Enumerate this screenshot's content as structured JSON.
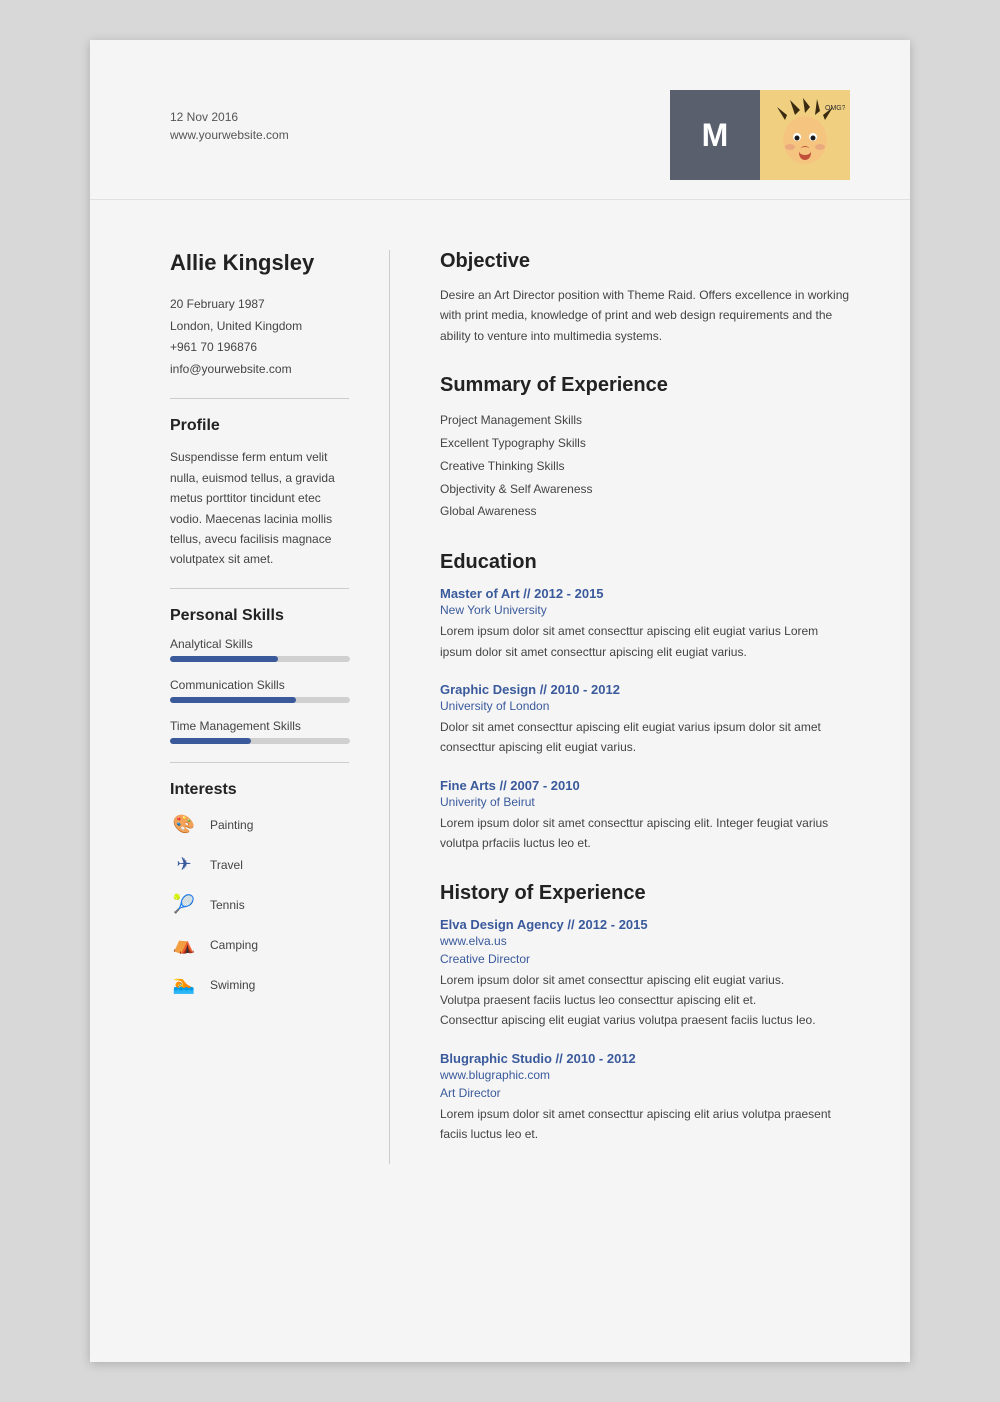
{
  "header": {
    "date": "12 Nov 2016",
    "website": "www.yourwebsite.com",
    "avatar_letter": "M"
  },
  "left": {
    "name": "Allie Kingsley",
    "contact": {
      "dob": "20 February 1987",
      "location": "London, United Kingdom",
      "phone": "+961 70 196876",
      "email": "info@yourwebsite.com"
    },
    "profile_title": "Profile",
    "profile_text": "Suspendisse ferm entum velit nulla, euismod tellus, a gravida metus porttitor tincidunt etec vodio. Maecenas lacinia mollis tellus, avecu facilisis magnace volutpatex sit amet.",
    "skills_title": "Personal Skills",
    "skills": [
      {
        "label": "Analytical Skills",
        "percent": 60
      },
      {
        "label": "Communication Skills",
        "percent": 70
      },
      {
        "label": "Time Management Skills",
        "percent": 45
      }
    ],
    "interests_title": "Interests",
    "interests": [
      {
        "label": "Painting",
        "icon": "🎨"
      },
      {
        "label": "Travel",
        "icon": "✈"
      },
      {
        "label": "Tennis",
        "icon": "🎾"
      },
      {
        "label": "Camping",
        "icon": "⛺"
      },
      {
        "label": "Swiming",
        "icon": "🏊"
      }
    ]
  },
  "right": {
    "objective_title": "Objective",
    "objective_text": "Desire an Art Director position with Theme Raid. Offers excellence in working with print media, knowledge of print and web design requirements and the ability to venture into multimedia systems.",
    "summary_title": "Summary of Experience",
    "summary_items": [
      "Project Management Skills",
      "Excellent Typography Skills",
      "Creative Thinking Skills",
      "Objectivity & Self Awareness",
      "Global Awareness"
    ],
    "education_title": "Education",
    "education": [
      {
        "title": "Master of Art // 2012 - 2015",
        "sub": "New York University",
        "text": "Lorem ipsum dolor sit amet consecttur apiscing elit eugiat varius Lorem ipsum dolor sit amet consecttur apiscing elit eugiat varius."
      },
      {
        "title": "Graphic Design // 2010 - 2012",
        "sub": "University of London",
        "text": "Dolor sit amet consecttur apiscing elit eugiat varius  ipsum dolor sit amet consecttur apiscing elit eugiat varius."
      },
      {
        "title": "Fine Arts // 2007 - 2010",
        "sub": "Univerity of Beirut",
        "text": "Lorem ipsum dolor sit amet consecttur apiscing elit. Integer feugiat varius volutpa prfaciis luctus leo et."
      }
    ],
    "experience_title": "History of Experience",
    "experience": [
      {
        "title": "Elva Design Agency // 2012 - 2015",
        "sub1": "www.elva.us",
        "sub2": "Creative Director",
        "text": "Lorem ipsum dolor sit amet consecttur apiscing elit eugiat varius.\nVolutpa praesent faciis luctus leo consecttur apiscing elit et.\nConsecttur apiscing elit eugiat varius volutpa praesent faciis luctus leo."
      },
      {
        "title": "Blugraphic Studio // 2010 - 2012",
        "sub1": "www.blugraphic.com",
        "sub2": "Art Director",
        "text": "Lorem ipsum dolor sit amet consecttur apiscing elit arius volutpa praesent faciis luctus leo et."
      }
    ]
  }
}
